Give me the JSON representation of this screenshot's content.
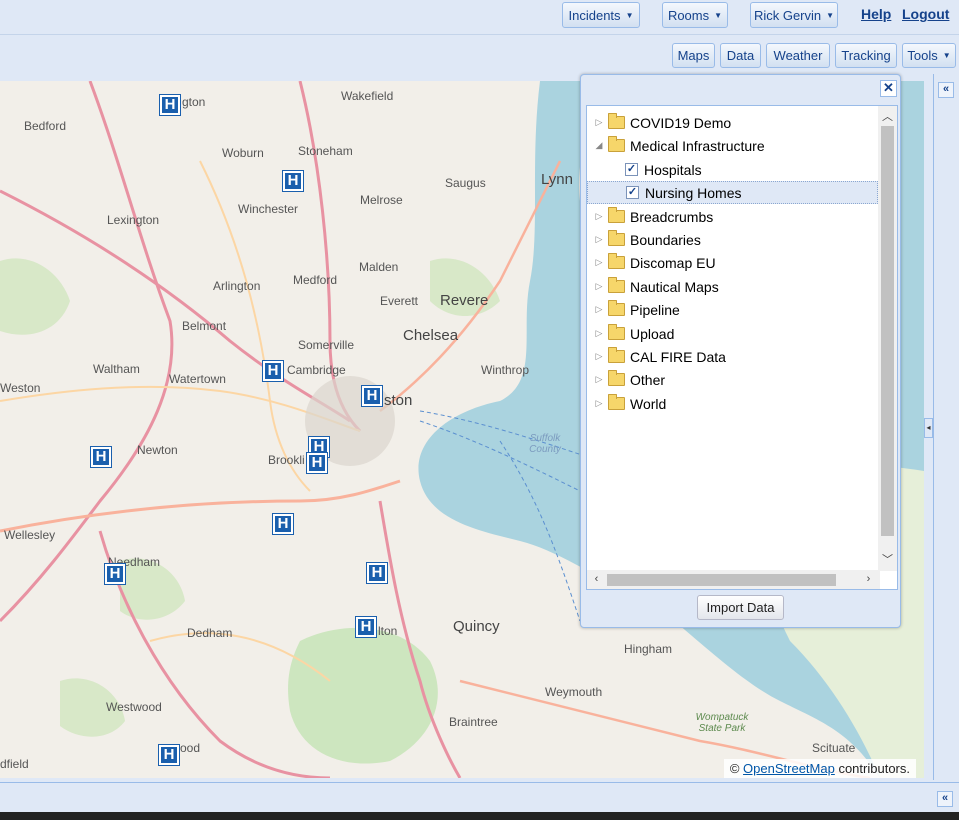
{
  "topbar": {
    "incidents_label": "Incidents",
    "rooms_label": "Rooms",
    "user_label": "Rick Gervin",
    "help_label": "Help",
    "logout_label": "Logout"
  },
  "toolbar": {
    "maps": "Maps",
    "data": "Data",
    "weather": "Weather",
    "tracking": "Tracking",
    "tools": "Tools"
  },
  "layer_panel": {
    "close_label": "✕",
    "import_label": "Import Data",
    "items": [
      {
        "label": "COVID19 Demo",
        "type": "folder",
        "expanded": false
      },
      {
        "label": "Medical Infrastructure",
        "type": "folder",
        "expanded": true
      },
      {
        "label": "Hospitals",
        "type": "layer",
        "checked": true
      },
      {
        "label": "Nursing Homes",
        "type": "layer",
        "checked": true,
        "selected": true
      },
      {
        "label": "Breadcrumbs",
        "type": "folder",
        "expanded": false
      },
      {
        "label": "Boundaries",
        "type": "folder",
        "expanded": false
      },
      {
        "label": "Discomap EU",
        "type": "folder",
        "expanded": false
      },
      {
        "label": "Nautical Maps",
        "type": "folder",
        "expanded": false
      },
      {
        "label": "Pipeline",
        "type": "folder",
        "expanded": false
      },
      {
        "label": "Upload",
        "type": "folder",
        "expanded": false
      },
      {
        "label": "CAL FIRE Data",
        "type": "folder",
        "expanded": false
      },
      {
        "label": "Other",
        "type": "folder",
        "expanded": false
      },
      {
        "label": "World",
        "type": "folder",
        "expanded": false
      }
    ]
  },
  "map": {
    "labels": {
      "bedford": "Bedford",
      "woburn": "Woburn",
      "stoneham": "Stoneham",
      "wakefield": "Wakefield",
      "lexington": "Lexington",
      "winchester": "Winchester",
      "melrose": "Melrose",
      "saugus": "Saugus",
      "lynn": "Lynn",
      "arlington": "Arlington",
      "medford": "Medford",
      "malden": "Malden",
      "everett": "Everett",
      "revere": "Revere",
      "belmont": "Belmont",
      "somerville": "Somerville",
      "chelsea": "Chelsea",
      "waltham": "Waltham",
      "watertown": "Watertown",
      "cambridge": "Cambridge",
      "winthrop": "Winthrop",
      "weston": "Weston",
      "boston": "ston",
      "newton": "Newton",
      "brookline": "Brookli",
      "suffolk": "Suffolk County",
      "wellesley": "Wellesley",
      "needham": "Needham",
      "dedham": "Dedham",
      "milton": "lton",
      "quincy": "Quincy",
      "hingham": "Hingham",
      "weymouth": "Weymouth",
      "westwood": "Westwood",
      "braintree": "Braintree",
      "wompatuck": "Wompatuck State Park",
      "scituate": "Scituate",
      "norwood": "ood",
      "burlington": "gton",
      "dedfield": "dfield"
    },
    "attribution_prefix": "©",
    "attribution_link": "OpenStreetMap",
    "attribution_suffix": "contributors.",
    "hospital_marker": "H"
  }
}
